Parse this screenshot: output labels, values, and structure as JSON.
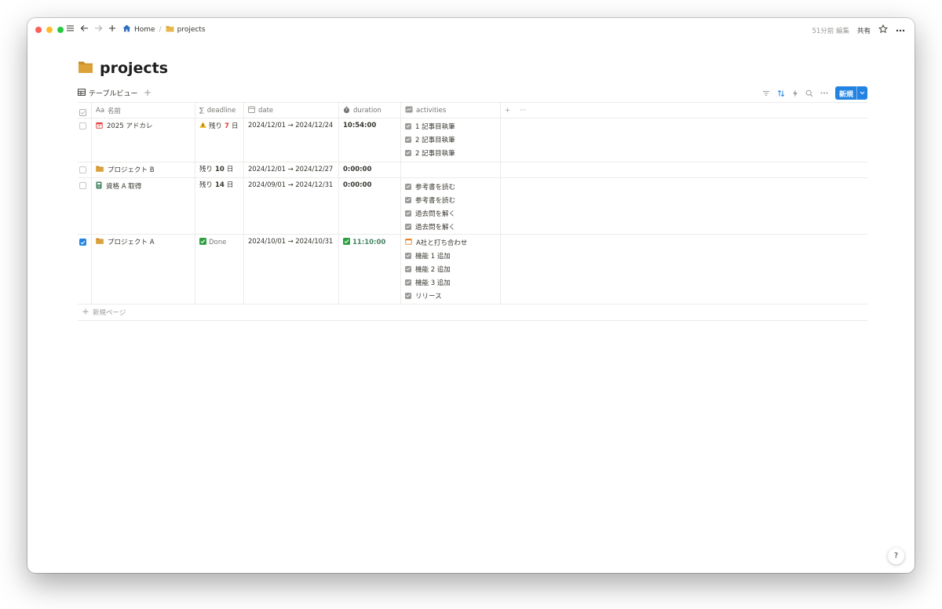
{
  "topbar": {
    "breadcrumbs": [
      {
        "label": "Home",
        "icon": "home-icon"
      },
      {
        "label": "projects",
        "icon": "folder-icon"
      }
    ],
    "separator": "/",
    "edited": "51分前 編集",
    "share": "共有"
  },
  "page": {
    "title": "projects",
    "icon": "folder-icon"
  },
  "view": {
    "tab_label": "テーブルビュー",
    "add": "+",
    "new_button": "新規"
  },
  "table": {
    "columns": {
      "name": "名前",
      "name_prefix": "Aa",
      "deadline": "deadline",
      "deadline_prefix": "∑",
      "date": "date",
      "duration": "duration",
      "activities": "activities",
      "add": "+",
      "more": "···"
    },
    "rows": [
      {
        "checked": false,
        "icon": "calendar-icon",
        "name": "2025 アドカレ",
        "deadline": {
          "prefix": "残り",
          "num": "7",
          "suffix": "日",
          "warning": true
        },
        "date": "2024/12/01 → 2024/12/24",
        "duration": "10:54:00",
        "activities": [
          "1 記事目執筆",
          "2 記事目執筆",
          "2 記事目執筆"
        ]
      },
      {
        "checked": false,
        "icon": "folder-icon",
        "name": "プロジェクト B",
        "deadline": {
          "prefix": "残り",
          "num": "10",
          "suffix": "日",
          "warning": false
        },
        "date": "2024/12/01 → 2024/12/27",
        "duration": "0:00:00",
        "activities": []
      },
      {
        "checked": false,
        "icon": "book-icon",
        "name": "資格 A 取得",
        "deadline": {
          "prefix": "残り",
          "num": "14",
          "suffix": "日",
          "warning": false
        },
        "date": "2024/09/01 → 2024/12/31",
        "duration": "0:00:00",
        "activities": [
          "参考書を読む",
          "参考書を読む",
          "過去問を解く",
          "過去問を解く"
        ]
      },
      {
        "checked": true,
        "icon": "folder-icon",
        "name": "プロジェクト A",
        "deadline_done": "Done",
        "date": "2024/10/01 → 2024/10/31",
        "duration": "11:10:00",
        "activities": [
          "A社と打ち合わせ",
          "機能 1 追加",
          "機能 2 追加",
          "機能 3 追加",
          "リリース"
        ]
      }
    ],
    "new_page": "新規ページ"
  },
  "help": "?",
  "colors": {
    "accent": "#2383e2",
    "folder": "#d9a53a",
    "red": "#e03e3e",
    "green": "#448361"
  }
}
